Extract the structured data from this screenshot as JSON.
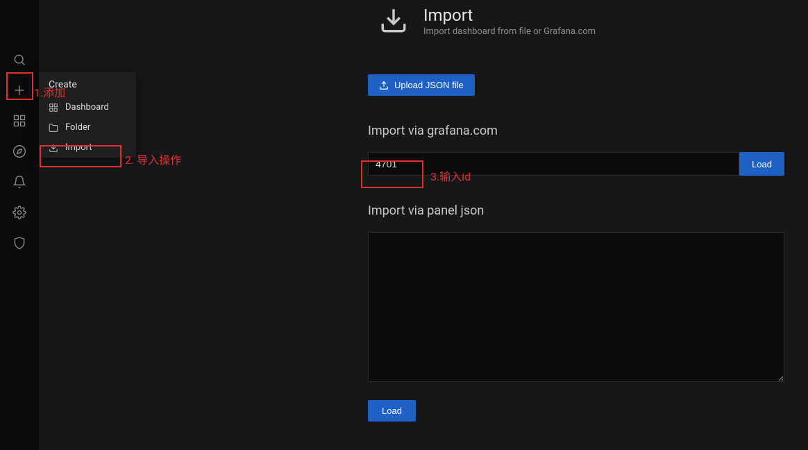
{
  "page": {
    "title": "Import",
    "subtitle": "Import dashboard from file or Grafana.com"
  },
  "flyout": {
    "header": "Create",
    "items": [
      {
        "label": "Dashboard"
      },
      {
        "label": "Folder"
      },
      {
        "label": "Import"
      }
    ]
  },
  "upload": {
    "button_label": "Upload JSON file"
  },
  "grafana_import": {
    "label": "Import via grafana.com",
    "input_value": "4701",
    "load_label": "Load"
  },
  "panel_json": {
    "label": "Import via panel json",
    "value": "",
    "load_label": "Load"
  },
  "annotations": {
    "a1": "1.添加",
    "a2": "2. 导入操作",
    "a3": "3.输入id"
  }
}
